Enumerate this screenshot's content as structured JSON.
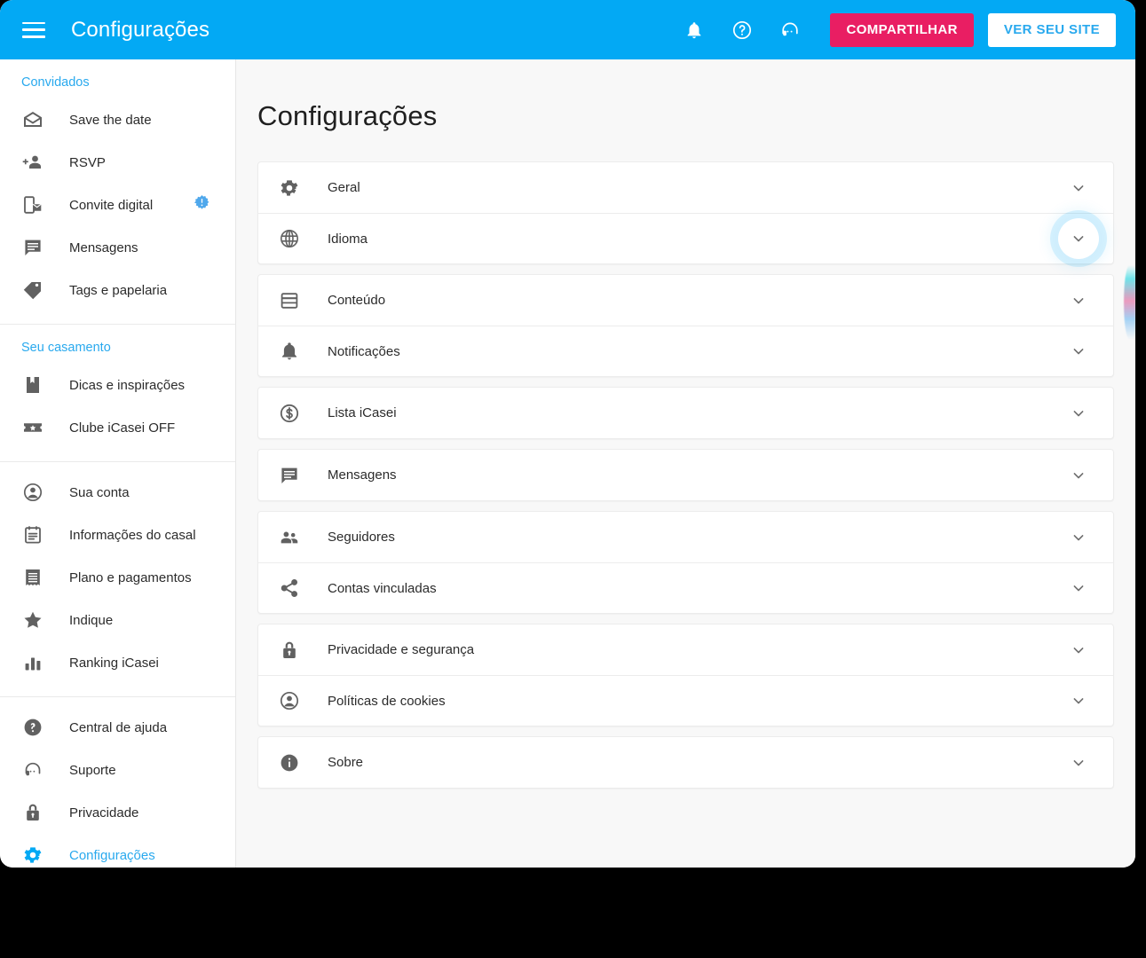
{
  "topbar": {
    "menu_icon": "hamburger-menu-icon",
    "title": "Configurações",
    "icons": [
      {
        "name": "notifications-bell-icon"
      },
      {
        "name": "help-circle-icon"
      },
      {
        "name": "support-headset-icon"
      }
    ],
    "share_button": "COMPARTILHAR",
    "site_button": "VER SEU SITE",
    "colors": {
      "bar": "#03a9f4",
      "share": "#e91e63",
      "site_text": "#29a9ee"
    }
  },
  "sidebar": {
    "groups": [
      {
        "heading": "Convidados",
        "items": [
          {
            "label": "Save the date",
            "icon": "mail-open-icon"
          },
          {
            "label": "RSVP",
            "icon": "person-add-icon"
          },
          {
            "label": "Convite digital",
            "icon": "mobile-invite-icon",
            "badge": "alert-badge-icon"
          },
          {
            "label": "Mensagens",
            "icon": "chat-bubble-icon"
          },
          {
            "label": "Tags e papelaria",
            "icon": "tag-icon"
          }
        ]
      },
      {
        "heading": "Seu casamento",
        "items": [
          {
            "label": "Dicas e inspirações",
            "icon": "book-bookmark-icon"
          },
          {
            "label": "Clube iCasei OFF",
            "icon": "ticket-star-icon"
          }
        ]
      },
      {
        "heading": "",
        "items": [
          {
            "label": "Sua conta",
            "icon": "account-circle-icon"
          },
          {
            "label": "Informações do casal",
            "icon": "contact-card-icon"
          },
          {
            "label": "Plano e pagamentos",
            "icon": "receipt-icon"
          },
          {
            "label": "Indique",
            "icon": "star-icon"
          },
          {
            "label": "Ranking iCasei",
            "icon": "bar-chart-icon"
          }
        ]
      },
      {
        "heading": "",
        "items": [
          {
            "label": "Central de ajuda",
            "icon": "help-circle-filled-icon"
          },
          {
            "label": "Suporte",
            "icon": "support-headset-icon"
          },
          {
            "label": "Privacidade",
            "icon": "lock-icon"
          },
          {
            "label": "Configurações",
            "icon": "gear-icon",
            "active": true
          }
        ]
      }
    ],
    "active_color": "#29a9ee",
    "heading_color": "#29a9ee"
  },
  "main": {
    "page_title": "Configurações",
    "cards": [
      {
        "rows": [
          {
            "label": "Geral",
            "icon": "gear-icon",
            "chevron": "chevron-down-icon"
          },
          {
            "label": "Idioma",
            "icon": "globe-icon",
            "chevron": "chevron-down-icon",
            "focused": true
          }
        ]
      },
      {
        "rows": [
          {
            "label": "Conteúdo",
            "icon": "web-layout-icon",
            "chevron": "chevron-down-icon"
          },
          {
            "label": "Notificações",
            "icon": "bell-icon",
            "chevron": "chevron-down-icon"
          }
        ]
      },
      {
        "rows": [
          {
            "label": "Lista iCasei",
            "icon": "money-circle-icon",
            "chevron": "chevron-down-icon"
          }
        ]
      },
      {
        "rows": [
          {
            "label": "Mensagens",
            "icon": "chat-bubble-icon",
            "chevron": "chevron-down-icon"
          }
        ]
      },
      {
        "rows": [
          {
            "label": "Seguidores",
            "icon": "people-icon",
            "chevron": "chevron-down-icon"
          },
          {
            "label": "Contas vinculadas",
            "icon": "share-nodes-icon",
            "chevron": "chevron-down-icon"
          }
        ]
      },
      {
        "rows": [
          {
            "label": "Privacidade e segurança",
            "icon": "lock-icon",
            "chevron": "chevron-down-icon"
          },
          {
            "label": "Políticas de cookies",
            "icon": "account-circle-icon",
            "chevron": "chevron-down-icon"
          }
        ]
      },
      {
        "rows": [
          {
            "label": "Sobre",
            "icon": "info-circle-icon",
            "chevron": "chevron-down-icon"
          }
        ]
      }
    ]
  }
}
